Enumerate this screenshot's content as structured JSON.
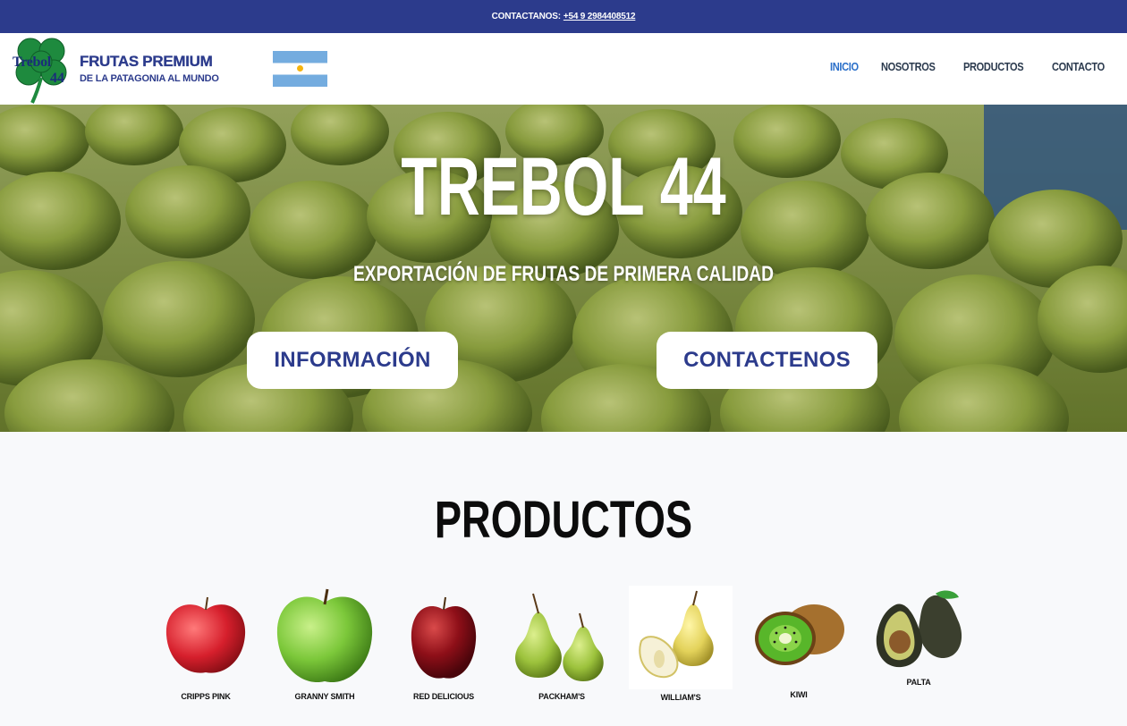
{
  "topbar": {
    "label": "CONTACTANOS:",
    "phone": "+54 9 2984408512"
  },
  "logo": {
    "word1": "Trebol",
    "word2": "44",
    "line1": "FRUTAS PREMIUM",
    "line2": "DE LA PATAGONIA AL MUNDO"
  },
  "nav": {
    "items": [
      {
        "label": "INICIO"
      },
      {
        "label": "NOSOTROS"
      },
      {
        "label": "PRODUCTOS"
      },
      {
        "label": "CONTACTO"
      }
    ]
  },
  "hero": {
    "title": "TREBOL 44",
    "subtitle": "EXPORTACIÓN DE FRUTAS DE PRIMERA CALIDAD",
    "button_info": "INFORMACIÓN",
    "button_contact": "CONTACTENOS"
  },
  "products": {
    "title": "PRODUCTOS",
    "items": [
      {
        "label": "CRIPPS PINK"
      },
      {
        "label": "GRANNY SMITH"
      },
      {
        "label": "RED DELICIOUS"
      },
      {
        "label": "PACKHAM'S"
      },
      {
        "label": "WILLIAM'S"
      },
      {
        "label": "KIWI"
      },
      {
        "label": "PALTA"
      }
    ]
  },
  "colors": {
    "brand_blue": "#2c3b8c",
    "nav_active": "#2a6fc9",
    "clover_green": "#1e8a3e"
  }
}
